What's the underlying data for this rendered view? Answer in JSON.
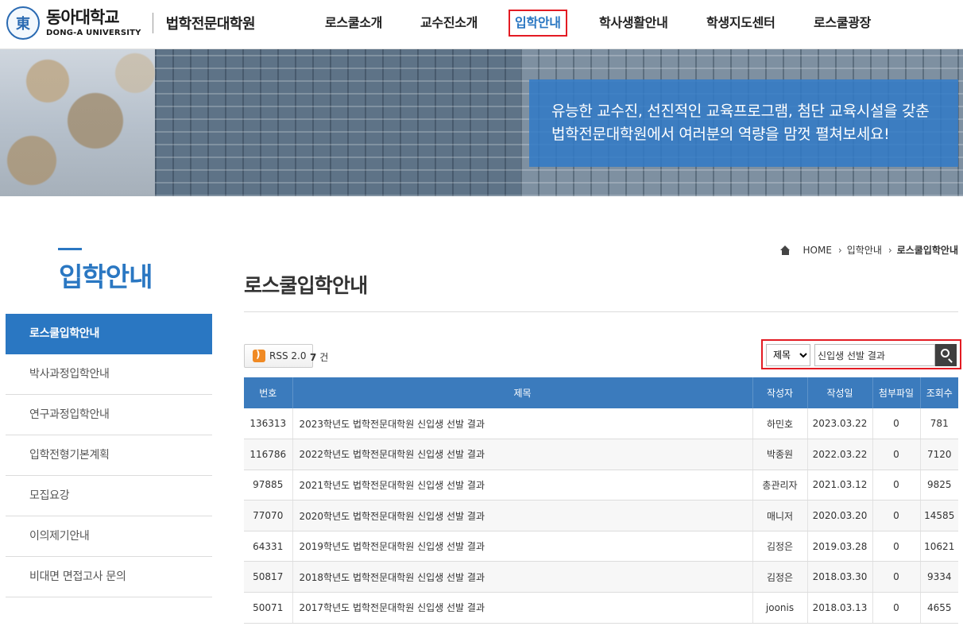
{
  "header": {
    "logo_kr": "동아대학교",
    "logo_en": "DONG-A UNIVERSITY",
    "subtitle": "법학전문대학원",
    "nav": [
      "로스쿨소개",
      "교수진소개",
      "입학안내",
      "학사생활안내",
      "학생지도센터",
      "로스쿨광장"
    ]
  },
  "banner": {
    "line1": "유능한 교수진, 선진적인 교육프로그램, 첨단 교육시설을 갖춘",
    "line2": "법학전문대학원에서 여러분의 역량을 맘껏 펼쳐보세요!"
  },
  "sidebar": {
    "title": "입학안내",
    "items": [
      "로스쿨입학안내",
      "박사과정입학안내",
      "연구과정입학안내",
      "입학전형기본계획",
      "모집요강",
      "이의제기안내",
      "비대면 면접고사 문의"
    ]
  },
  "breadcrumb": {
    "home": "HOME",
    "level1": "입학안내",
    "current": "로스쿨입학안내"
  },
  "page_title": "로스쿨입학안내",
  "toolbar": {
    "rss_label": "RSS 2.0",
    "count": "7",
    "count_unit": "건"
  },
  "search": {
    "field": "제목",
    "value": "신입생 선발 결과"
  },
  "table": {
    "headers": [
      "번호",
      "제목",
      "작성자",
      "작성일",
      "첨부파일",
      "조회수"
    ],
    "rows": [
      [
        "136313",
        "2023학년도 법학전문대학원 신입생 선발 결과",
        "하민호",
        "2023.03.22",
        "0",
        "781"
      ],
      [
        "116786",
        "2022학년도 법학전문대학원 신입생 선발 결과",
        "박종원",
        "2022.03.22",
        "0",
        "7120"
      ],
      [
        "97885",
        "2021학년도 법학전문대학원 신입생 선발 결과",
        "총관리자",
        "2021.03.12",
        "0",
        "9825"
      ],
      [
        "77070",
        "2020학년도 법학전문대학원 신입생 선발 결과",
        "매니저",
        "2020.03.20",
        "0",
        "14585"
      ],
      [
        "64331",
        "2019학년도 법학전문대학원 신입생 선발 결과",
        "김정은",
        "2019.03.28",
        "0",
        "10621"
      ],
      [
        "50817",
        "2018학년도 법학전문대학원 신입생 선발 결과",
        "김정은",
        "2018.03.30",
        "0",
        "9334"
      ],
      [
        "50071",
        "2017학년도 법학전문대학원 신입생 선발 결과",
        "joonis",
        "2018.03.13",
        "0",
        "4655"
      ]
    ]
  }
}
